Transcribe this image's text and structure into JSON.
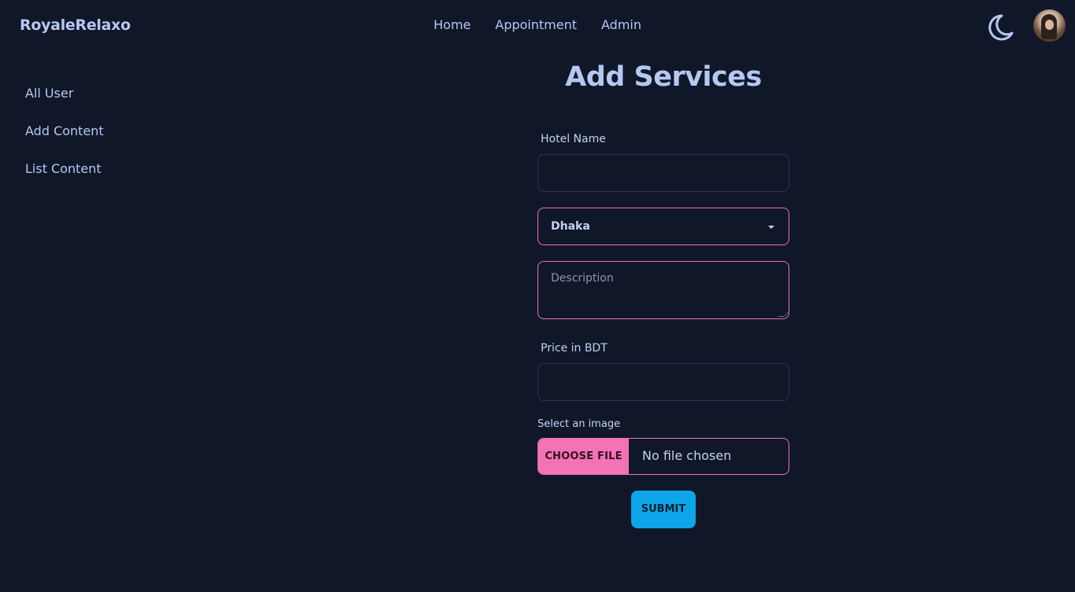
{
  "navbar": {
    "brand": "RoyaleRelaxo",
    "links": [
      "Home",
      "Appointment",
      "Admin"
    ],
    "theme_icon": "moon-icon",
    "avatar_icon": "user-avatar"
  },
  "sidebar": {
    "items": [
      "All User",
      "Add Content",
      "List Content"
    ]
  },
  "main": {
    "title": "Add Services",
    "form": {
      "hotel_name_label": "Hotel Name",
      "hotel_name_value": "",
      "location_selected": "Dhaka",
      "description_placeholder": "Description",
      "price_label": "Price in BDT",
      "price_value": "",
      "image_label": "Select an image",
      "file_button": "CHOOSE FILE",
      "file_status": "No file chosen",
      "submit_label": "SUBMIT"
    }
  },
  "colors": {
    "background": "#101729",
    "accent_pink": "#f472b6",
    "accent_blue": "#0ea5e9",
    "text": "#b6c8f1"
  }
}
